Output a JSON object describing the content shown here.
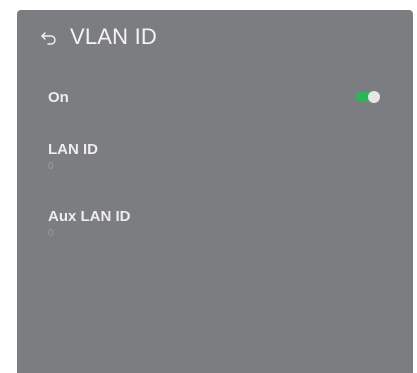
{
  "header": {
    "title": "VLAN ID",
    "back_icon": "back-arrow-icon"
  },
  "settings": {
    "on": {
      "label": "On",
      "toggle_state": "on",
      "toggle_color": "#2db35a"
    },
    "lan_id": {
      "label": "LAN ID",
      "value": "0"
    },
    "aux_lan_id": {
      "label": "Aux LAN ID",
      "value": "0"
    }
  },
  "colors": {
    "panel_bg": "#7c7d80",
    "text_primary": "#ededed",
    "text_secondary": "#9a9b9e"
  }
}
